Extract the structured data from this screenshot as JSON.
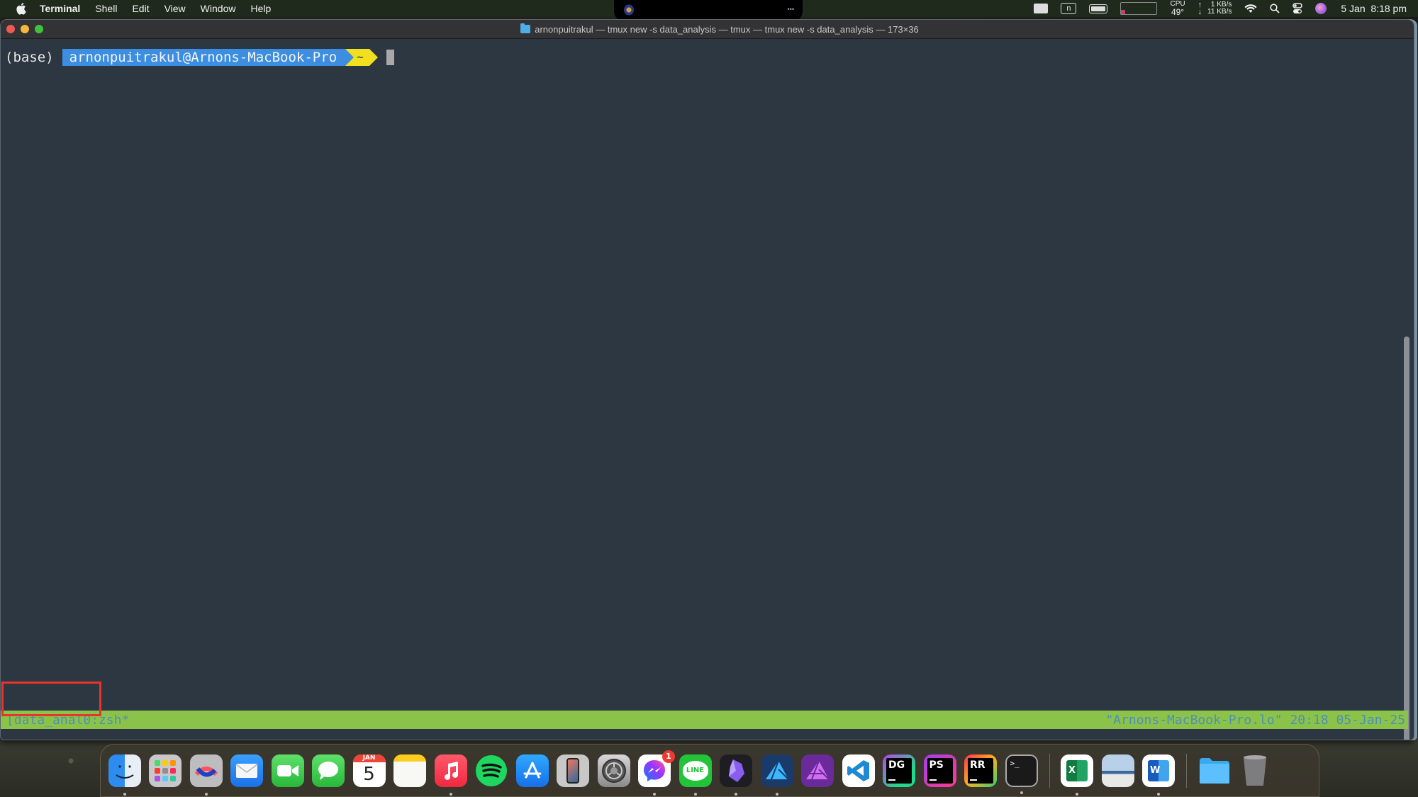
{
  "menubar": {
    "app_name": "Terminal",
    "menus": [
      "Shell",
      "Edit",
      "View",
      "Window",
      "Help"
    ],
    "status": {
      "cpu_label": "CPU",
      "cpu_temp": "49°",
      "net_up": "1 KB/s",
      "net_down": "11 KB/s",
      "input_source": "n",
      "date": "5 Jan",
      "time": "8:18 pm"
    }
  },
  "window": {
    "title": "arnonpuitrakul — tmux new -s data_analysis — tmux — tmux new -s data_analysis — 173×36",
    "prompt": {
      "env": "(base)",
      "user_host": "arnonpuitrakul@Arnons-MacBook-Pro",
      "cwd": "~"
    },
    "tmux_status": {
      "session": "[data_anal0",
      "window": ":zsh*",
      "right": "\"Arnons-MacBook-Pro.lo\" 20:18 05-Jan-25"
    }
  },
  "dock": {
    "calendar_month": "JAN",
    "calendar_day": "5",
    "messenger_badge": "1",
    "line_label": "LINE",
    "dg_label": "DG",
    "ps_label": "PS",
    "rr_label": "RR",
    "terminal_label": ">_",
    "excel_label": "X",
    "word_label": "W"
  }
}
